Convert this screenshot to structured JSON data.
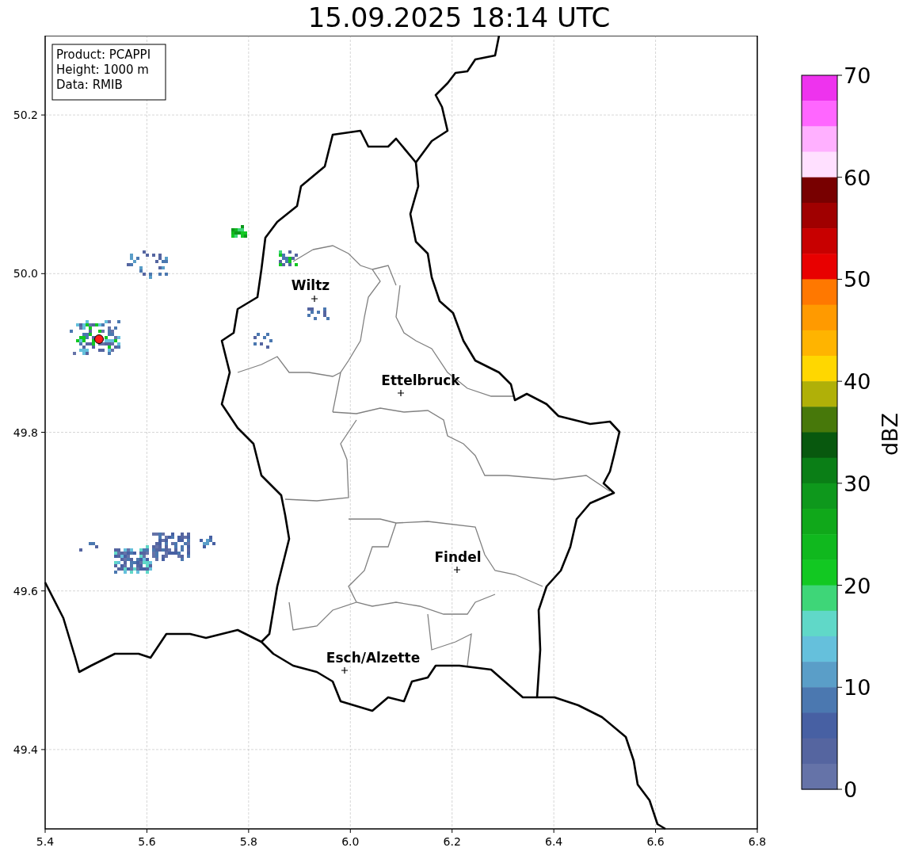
{
  "title": "15.09.2025 18:14 UTC",
  "info_box": [
    "Product: PCAPPI",
    "Height: 1000 m",
    "Data: RMIB"
  ],
  "x_ticks": [
    "5.4",
    "5.6",
    "5.8",
    "6.0",
    "6.2",
    "6.4",
    "6.6",
    "6.8"
  ],
  "y_ticks": [
    "50.2",
    "50.0",
    "49.8",
    "49.6",
    "49.4"
  ],
  "cities": [
    "Wiltz",
    "Ettelbruck",
    "Findel",
    "Esch/Alzette"
  ],
  "colorbar": {
    "label": "dBZ",
    "ticks": [
      "70",
      "60",
      "50",
      "40",
      "30",
      "20",
      "10",
      "0"
    ],
    "segments": [
      {
        "color": "#ee33ee"
      },
      {
        "color": "#ff66ff"
      },
      {
        "color": "#ffb0ff"
      },
      {
        "color": "#ffe0ff"
      },
      {
        "color": "#780000"
      },
      {
        "color": "#a00000"
      },
      {
        "color": "#c80000"
      },
      {
        "color": "#e80000"
      },
      {
        "color": "#ff7800"
      },
      {
        "color": "#ff9a00"
      },
      {
        "color": "#ffb400"
      },
      {
        "color": "#ffd700"
      },
      {
        "color": "#b0b008"
      },
      {
        "color": "#47780a"
      },
      {
        "color": "#08580e"
      },
      {
        "color": "#0a7e16"
      },
      {
        "color": "#0e981c"
      },
      {
        "color": "#10a81a"
      },
      {
        "color": "#10b81e"
      },
      {
        "color": "#12c822"
      },
      {
        "color": "#3ed678"
      },
      {
        "color": "#60d8c8"
      },
      {
        "color": "#65c0dc"
      },
      {
        "color": "#5a9ec8"
      },
      {
        "color": "#4b78b0"
      },
      {
        "color": "#4760a3"
      },
      {
        "color": "#5565a0"
      },
      {
        "color": "#6573a8"
      }
    ]
  }
}
